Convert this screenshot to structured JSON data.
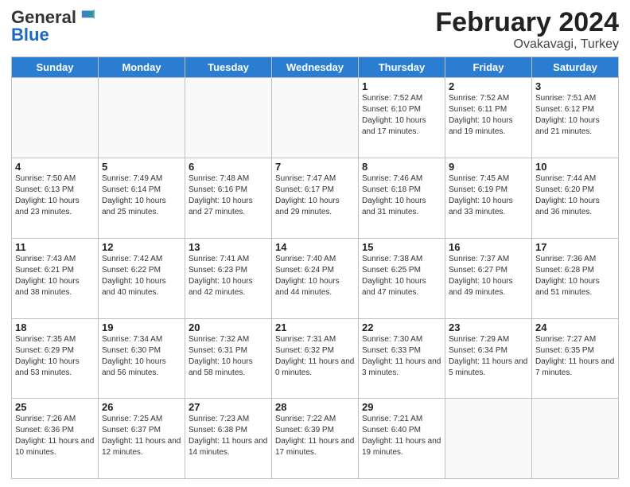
{
  "header": {
    "logo_general": "General",
    "logo_blue": "Blue",
    "title": "February 2024",
    "subtitle": "Ovakavagi, Turkey"
  },
  "days_of_week": [
    "Sunday",
    "Monday",
    "Tuesday",
    "Wednesday",
    "Thursday",
    "Friday",
    "Saturday"
  ],
  "weeks": [
    [
      {
        "day": "",
        "info": ""
      },
      {
        "day": "",
        "info": ""
      },
      {
        "day": "",
        "info": ""
      },
      {
        "day": "",
        "info": ""
      },
      {
        "day": "1",
        "info": "Sunrise: 7:52 AM\nSunset: 6:10 PM\nDaylight: 10 hours and 17 minutes."
      },
      {
        "day": "2",
        "info": "Sunrise: 7:52 AM\nSunset: 6:11 PM\nDaylight: 10 hours and 19 minutes."
      },
      {
        "day": "3",
        "info": "Sunrise: 7:51 AM\nSunset: 6:12 PM\nDaylight: 10 hours and 21 minutes."
      }
    ],
    [
      {
        "day": "4",
        "info": "Sunrise: 7:50 AM\nSunset: 6:13 PM\nDaylight: 10 hours and 23 minutes."
      },
      {
        "day": "5",
        "info": "Sunrise: 7:49 AM\nSunset: 6:14 PM\nDaylight: 10 hours and 25 minutes."
      },
      {
        "day": "6",
        "info": "Sunrise: 7:48 AM\nSunset: 6:16 PM\nDaylight: 10 hours and 27 minutes."
      },
      {
        "day": "7",
        "info": "Sunrise: 7:47 AM\nSunset: 6:17 PM\nDaylight: 10 hours and 29 minutes."
      },
      {
        "day": "8",
        "info": "Sunrise: 7:46 AM\nSunset: 6:18 PM\nDaylight: 10 hours and 31 minutes."
      },
      {
        "day": "9",
        "info": "Sunrise: 7:45 AM\nSunset: 6:19 PM\nDaylight: 10 hours and 33 minutes."
      },
      {
        "day": "10",
        "info": "Sunrise: 7:44 AM\nSunset: 6:20 PM\nDaylight: 10 hours and 36 minutes."
      }
    ],
    [
      {
        "day": "11",
        "info": "Sunrise: 7:43 AM\nSunset: 6:21 PM\nDaylight: 10 hours and 38 minutes."
      },
      {
        "day": "12",
        "info": "Sunrise: 7:42 AM\nSunset: 6:22 PM\nDaylight: 10 hours and 40 minutes."
      },
      {
        "day": "13",
        "info": "Sunrise: 7:41 AM\nSunset: 6:23 PM\nDaylight: 10 hours and 42 minutes."
      },
      {
        "day": "14",
        "info": "Sunrise: 7:40 AM\nSunset: 6:24 PM\nDaylight: 10 hours and 44 minutes."
      },
      {
        "day": "15",
        "info": "Sunrise: 7:38 AM\nSunset: 6:25 PM\nDaylight: 10 hours and 47 minutes."
      },
      {
        "day": "16",
        "info": "Sunrise: 7:37 AM\nSunset: 6:27 PM\nDaylight: 10 hours and 49 minutes."
      },
      {
        "day": "17",
        "info": "Sunrise: 7:36 AM\nSunset: 6:28 PM\nDaylight: 10 hours and 51 minutes."
      }
    ],
    [
      {
        "day": "18",
        "info": "Sunrise: 7:35 AM\nSunset: 6:29 PM\nDaylight: 10 hours and 53 minutes."
      },
      {
        "day": "19",
        "info": "Sunrise: 7:34 AM\nSunset: 6:30 PM\nDaylight: 10 hours and 56 minutes."
      },
      {
        "day": "20",
        "info": "Sunrise: 7:32 AM\nSunset: 6:31 PM\nDaylight: 10 hours and 58 minutes."
      },
      {
        "day": "21",
        "info": "Sunrise: 7:31 AM\nSunset: 6:32 PM\nDaylight: 11 hours and 0 minutes."
      },
      {
        "day": "22",
        "info": "Sunrise: 7:30 AM\nSunset: 6:33 PM\nDaylight: 11 hours and 3 minutes."
      },
      {
        "day": "23",
        "info": "Sunrise: 7:29 AM\nSunset: 6:34 PM\nDaylight: 11 hours and 5 minutes."
      },
      {
        "day": "24",
        "info": "Sunrise: 7:27 AM\nSunset: 6:35 PM\nDaylight: 11 hours and 7 minutes."
      }
    ],
    [
      {
        "day": "25",
        "info": "Sunrise: 7:26 AM\nSunset: 6:36 PM\nDaylight: 11 hours and 10 minutes."
      },
      {
        "day": "26",
        "info": "Sunrise: 7:25 AM\nSunset: 6:37 PM\nDaylight: 11 hours and 12 minutes."
      },
      {
        "day": "27",
        "info": "Sunrise: 7:23 AM\nSunset: 6:38 PM\nDaylight: 11 hours and 14 minutes."
      },
      {
        "day": "28",
        "info": "Sunrise: 7:22 AM\nSunset: 6:39 PM\nDaylight: 11 hours and 17 minutes."
      },
      {
        "day": "29",
        "info": "Sunrise: 7:21 AM\nSunset: 6:40 PM\nDaylight: 11 hours and 19 minutes."
      },
      {
        "day": "",
        "info": ""
      },
      {
        "day": "",
        "info": ""
      }
    ]
  ]
}
